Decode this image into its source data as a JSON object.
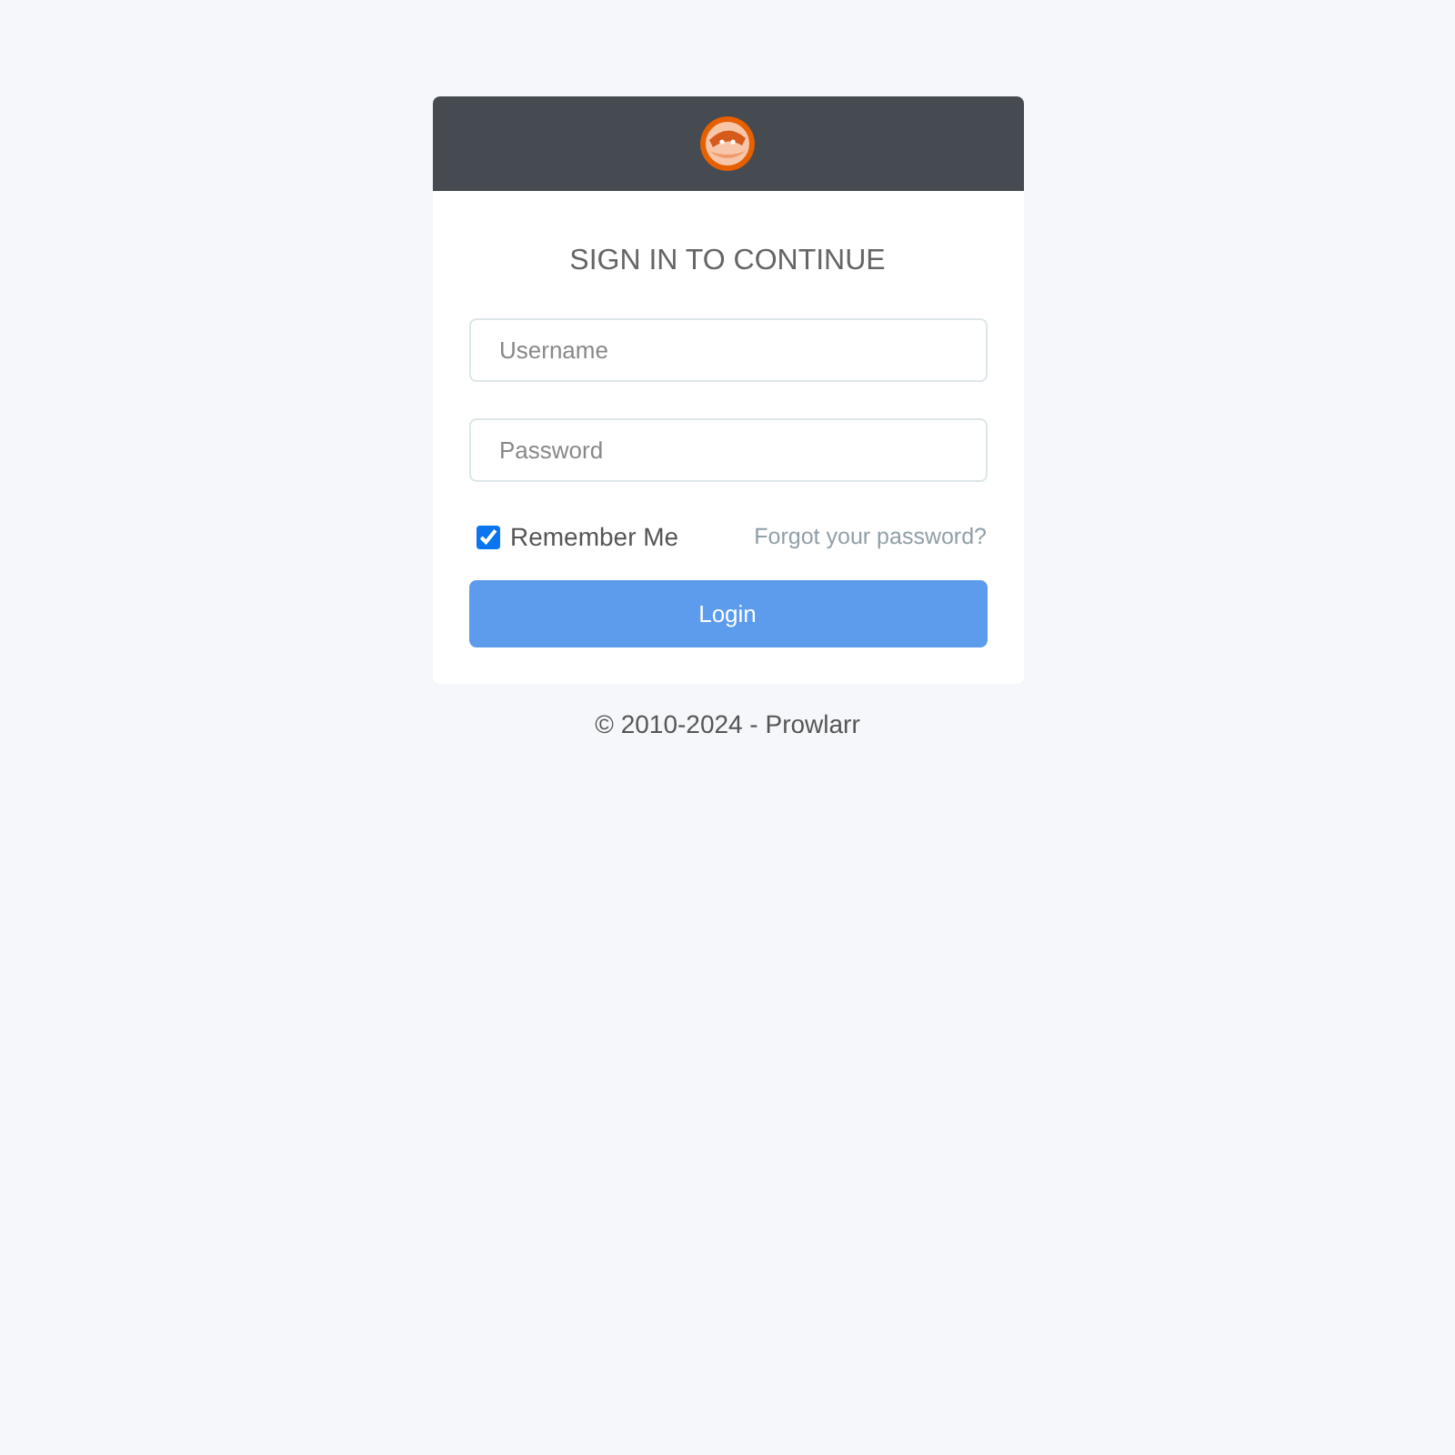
{
  "heading": "SIGN IN TO CONTINUE",
  "username": {
    "placeholder": "Username"
  },
  "password": {
    "placeholder": "Password"
  },
  "remember": {
    "label": "Remember Me",
    "checked": true
  },
  "forgot_link": "Forgot your password?",
  "login_button": "Login",
  "footer": "© 2010-2024 - Prowlarr"
}
